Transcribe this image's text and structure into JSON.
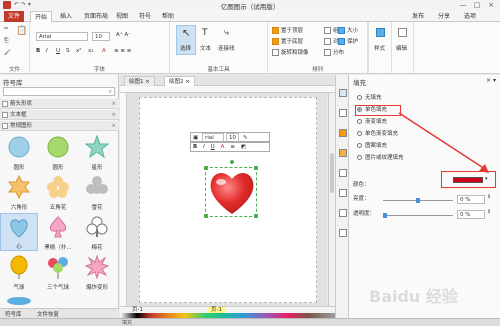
{
  "window": {
    "title": "亿图图示（试用版）",
    "controls": [
      "—",
      "□",
      "×"
    ]
  },
  "menu": {
    "file": "文件",
    "tabs": [
      "开始",
      "插入",
      "页面布局",
      "视图",
      "符号",
      "帮助"
    ],
    "right_items": [
      "发布",
      "分享",
      "选项"
    ]
  },
  "ribbon": {
    "font_name": "Arial",
    "font_size": "10",
    "groups": [
      "文件",
      "字体",
      "基本工具",
      "排列",
      "样式",
      "编辑"
    ],
    "tools": [
      "选择",
      "文本",
      "连接线"
    ],
    "arrange": [
      "置于顶层",
      "置于底层",
      "组合",
      "对齐",
      "旋转和镜像",
      "分布",
      "大小",
      "保护"
    ],
    "style_label": "样式",
    "edit_label": "编辑"
  },
  "library": {
    "title": "符号库",
    "categories": [
      "箭头形状",
      "文本框",
      "常规图形"
    ],
    "shapes": [
      "圆形",
      "圆形",
      "星形",
      "六角形",
      "五角花",
      "雪花",
      "心",
      "黑桃（扑…",
      "梅花",
      "气球",
      "三个气球",
      "爆炸",
      "符号库",
      "文件恢复"
    ],
    "shape_labels": [
      "圆形",
      "圆形",
      "星形",
      "六角形",
      "五角花",
      "雪花",
      "心",
      "黑桃（扑...",
      "梅花",
      "气球",
      "三个气球",
      "爆炸变形"
    ],
    "tabs": [
      "符号库",
      "文件恢复"
    ]
  },
  "doc_tabs": [
    "绘图1",
    "绘图2"
  ],
  "mini_toolbar": {
    "font": "rial",
    "size": "10",
    "buttons": [
      "B",
      "I",
      "U",
      "A"
    ]
  },
  "fill": {
    "title": "填充",
    "options": [
      "无填充",
      "单色填充",
      "渐变填充",
      "单色渐变填充",
      "图案填充",
      "图片或纹理填充"
    ],
    "selected_option": "单色填充",
    "color_label": "颜色：",
    "color_value": "#d0021b",
    "brightness_label": "亮度：",
    "brightness_value": "0 %",
    "transparency_label": "透明度：",
    "transparency_value": "0 %"
  },
  "status": {
    "page": "页-1",
    "page_tab": "页-1",
    "fill_label": "填充"
  },
  "colors": {
    "accent": "#c0392b",
    "heart": "#e32b2b",
    "annotation": "#e53935"
  }
}
